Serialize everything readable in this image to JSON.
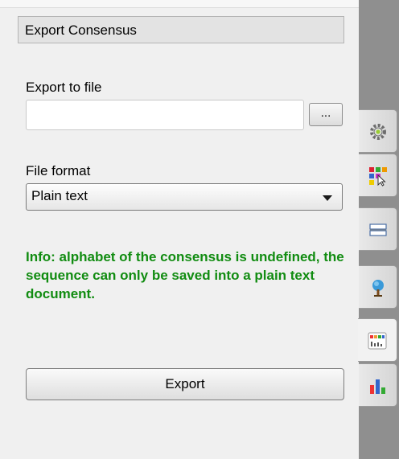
{
  "group": {
    "title": "Export Consensus"
  },
  "export_file": {
    "label": "Export to file",
    "value": "",
    "browse_label": "..."
  },
  "file_format": {
    "label": "File format",
    "selected": "Plain text"
  },
  "info": {
    "text": "Info: alphabet of the consensus is undefined, the sequence can only be saved into a plain text document."
  },
  "actions": {
    "export_label": "Export"
  },
  "side_tabs": [
    {
      "icon": "settings-icon",
      "active": false
    },
    {
      "icon": "color-scheme-icon",
      "active": false
    },
    {
      "icon": "statistics-icon",
      "active": false
    },
    {
      "icon": "tree-icon",
      "active": false
    },
    {
      "icon": "consensus-icon",
      "active": true
    },
    {
      "icon": "chart-icon",
      "active": false
    }
  ],
  "colors": {
    "info_text": "#118c11",
    "sidebar": "#8f8f8f",
    "panel": "#f0f0f0"
  }
}
